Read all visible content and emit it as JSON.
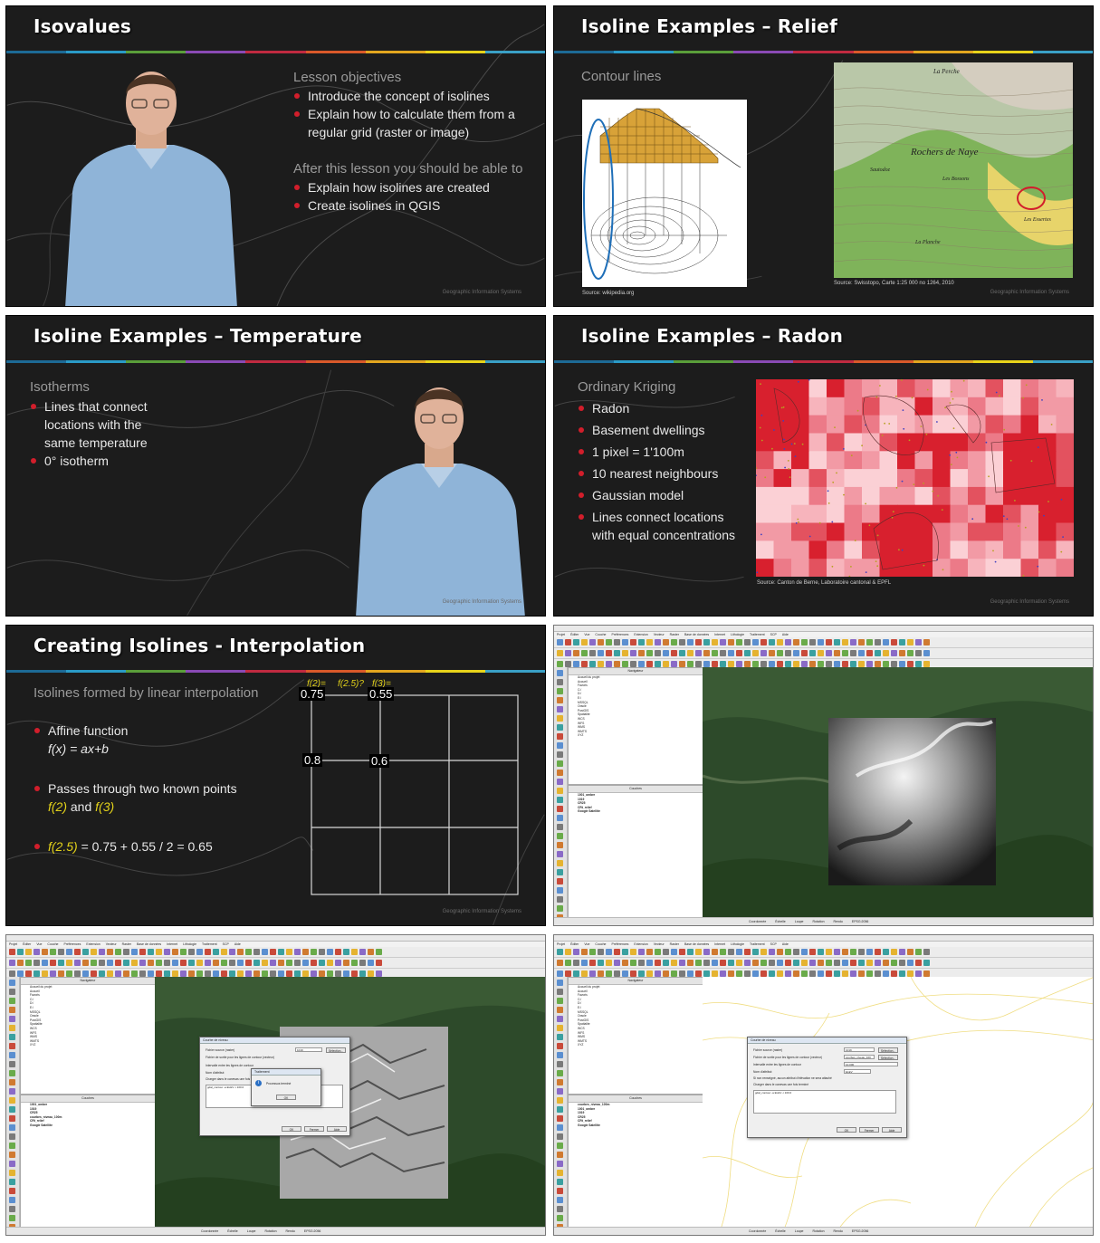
{
  "slides": {
    "isovalues": {
      "title": "Isovalues",
      "objectives_heading": "Lesson objectives",
      "objectives": [
        "Introduce the concept of isolines",
        "Explain how to calculate them from a regular grid (raster or image)"
      ],
      "after_heading": "After this lesson you should be able to",
      "after": [
        "Explain how isolines are created",
        "Create isolines in QGIS"
      ],
      "footer": "Geographic Information Systems"
    },
    "relief": {
      "title": "Isoline Examples – Relief",
      "heading": "Contour lines",
      "source_left": "Source: wikipedia.org",
      "source_right": "Source: Swisstopo, Carte 1:25 000 no 1264, 2010",
      "map_labels": [
        "La Perche",
        "Rochers de Naye",
        "Sautodoz",
        "Les Bossons",
        "Les Essertes",
        "La Planche"
      ],
      "footer": "Geographic Information Systems"
    },
    "temperature": {
      "title": "Isoline Examples – Temperature",
      "heading": "Isotherms",
      "bullets": [
        "Lines that connect locations with the same temperature",
        "0°   isotherm"
      ],
      "footer": "Geographic Information Systems"
    },
    "radon": {
      "title": "Isoline Examples – Radon",
      "heading": "Ordinary Kriging",
      "bullets": [
        "Radon",
        "Basement dwellings",
        "1 pixel = 1'100m",
        "10 nearest neighbours",
        "Gaussian model",
        "Lines connect locations with equal concentrations"
      ],
      "source": "Source: Canton de Berne, Laboratoire cantonal & EPFL",
      "footer": "Geographic Information Systems"
    },
    "interpolation": {
      "title": "Creating Isolines - Interpolation",
      "heading": "Isolines formed by linear interpolation",
      "bullet1": "Affine function",
      "bullet1_formula": "f(x) = ax+b",
      "bullet2": "Passes through two known points",
      "bullet2_f2": "f(2)",
      "bullet2_and": " and ",
      "bullet2_f3": "f(3)",
      "bullet3_f": "f(2.5)",
      "bullet3_rest": " = 0.75 + 0.55 / 2 = 0.65",
      "grid_top_labels": [
        "f(2)=",
        "f(2.5)?",
        "f(3)="
      ],
      "grid_values": [
        "0.75",
        "0.55",
        "0.8",
        "0.6"
      ],
      "footer": "Geographic Information Systems"
    }
  },
  "qgis": {
    "menu": [
      "Projet",
      "Éditer",
      "Vue",
      "Couche",
      "Préférences",
      "Extension",
      "Vecteur",
      "Raster",
      "Base de données",
      "Internet",
      "Lithologie",
      "Traitement",
      "SCP",
      "Aide"
    ],
    "browser_title": "Navigateur",
    "browser_items": [
      "Accueil du projet",
      "Accueil",
      "Favoris",
      "C:/",
      "D:/",
      "E:/",
      "MSSQL",
      "Oracle",
      "PostGIS",
      "Spatialite",
      "WCS",
      "WFS",
      "WMS",
      "WMTS",
      "XYZ"
    ],
    "layers_title": "Couches",
    "layers_a": [
      "1001_ombre",
      "1019",
      "CR25",
      "CRt_relief",
      "Google Satellite"
    ],
    "layers_b": [
      "1001_ombre",
      "1019",
      "CR25",
      "courbes_niveau_100m",
      "CRt_relief",
      "Google Satellite"
    ],
    "layers_c": [
      "courbes_niveau_100m",
      "1001_ombre",
      "1019",
      "CR25",
      "CRt_relief",
      "Google Satellite"
    ],
    "status": [
      "Coordonnée",
      "Échelle",
      "Loupe",
      "Rotation",
      "Rendu",
      "EPSG:2056"
    ],
    "dialog_title": "Courbe de niveau",
    "dialog_rows": [
      "Fichier source (raster)",
      "Fichier de sortie pour les lignes de contour (vecteur)",
      "Intervalle entre les lignes de contour",
      "Nom d'attribut",
      "Si non renseigné, aucun attribut d'élévation ne sera attaché",
      "Charger dans le canevas une fois terminé"
    ],
    "dialog_input_values": [
      "1019",
      "courbes_niveau_100",
      "10.000",
      "ELEV"
    ],
    "dialog_browse": "Sélection...",
    "dialog_command": "gdal_contour -a ELEV -i 100.0",
    "dialog_buttons": [
      "OK",
      "Fermer",
      "Aide"
    ],
    "msg_title": "Traitement",
    "msg_text": "Processus terminé",
    "msg_ok": "OK"
  },
  "colors": {
    "accent_red": "#d21e2b",
    "rainbow": [
      "#1d6a96",
      "#2a9ac7",
      "#5a9e3a",
      "#8a4ab5",
      "#c02a40",
      "#d9592a",
      "#e3a61f",
      "#e8d31a",
      "#3aa0c6"
    ]
  }
}
